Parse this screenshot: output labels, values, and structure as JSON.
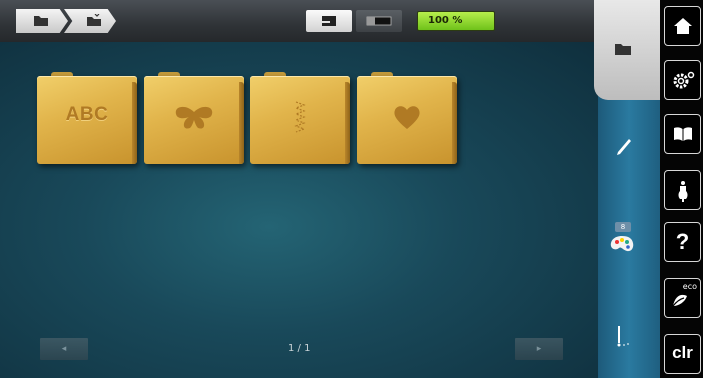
{
  "header": {
    "breadcrumbs": [
      {
        "icon": "folder-icon"
      },
      {
        "icon": "folder-open-icon"
      }
    ],
    "stitch_mode_icon": "sewing-machine-icon",
    "embroidery_mode_icon": "embroidery-module-icon",
    "progress_label": "100 %",
    "progress_color": "#8fd62a"
  },
  "main": {
    "folders": [
      {
        "label": "ABC",
        "icon": "alphabet-icon"
      },
      {
        "icon": "butterfly-icon"
      },
      {
        "icon": "stitch-sample-icon"
      },
      {
        "icon": "heart-icon"
      }
    ],
    "pager": "1 / 1",
    "prev_label": "◂",
    "next_label": "▸"
  },
  "side_panel": {
    "items": [
      {
        "icon": "folder-icon",
        "active": true
      },
      {
        "icon": "pencil-icon"
      },
      {
        "icon": "color-palette-icon",
        "badge": "8"
      },
      {
        "icon": "needle-icon"
      }
    ]
  },
  "system_buttons": [
    {
      "icon": "home-icon"
    },
    {
      "icon": "settings-icon"
    },
    {
      "icon": "tutorial-book-icon"
    },
    {
      "icon": "creative-consultant-icon"
    },
    {
      "label": "?",
      "icon": "help-icon"
    },
    {
      "icon": "eco-mode-icon",
      "label": "eco"
    },
    {
      "label": "clr",
      "icon": "clear-icon"
    }
  ],
  "colors": {
    "content_bg": "#19495a",
    "folder_gold": "#e1b44b",
    "side_panel": "#2a7aa0"
  }
}
